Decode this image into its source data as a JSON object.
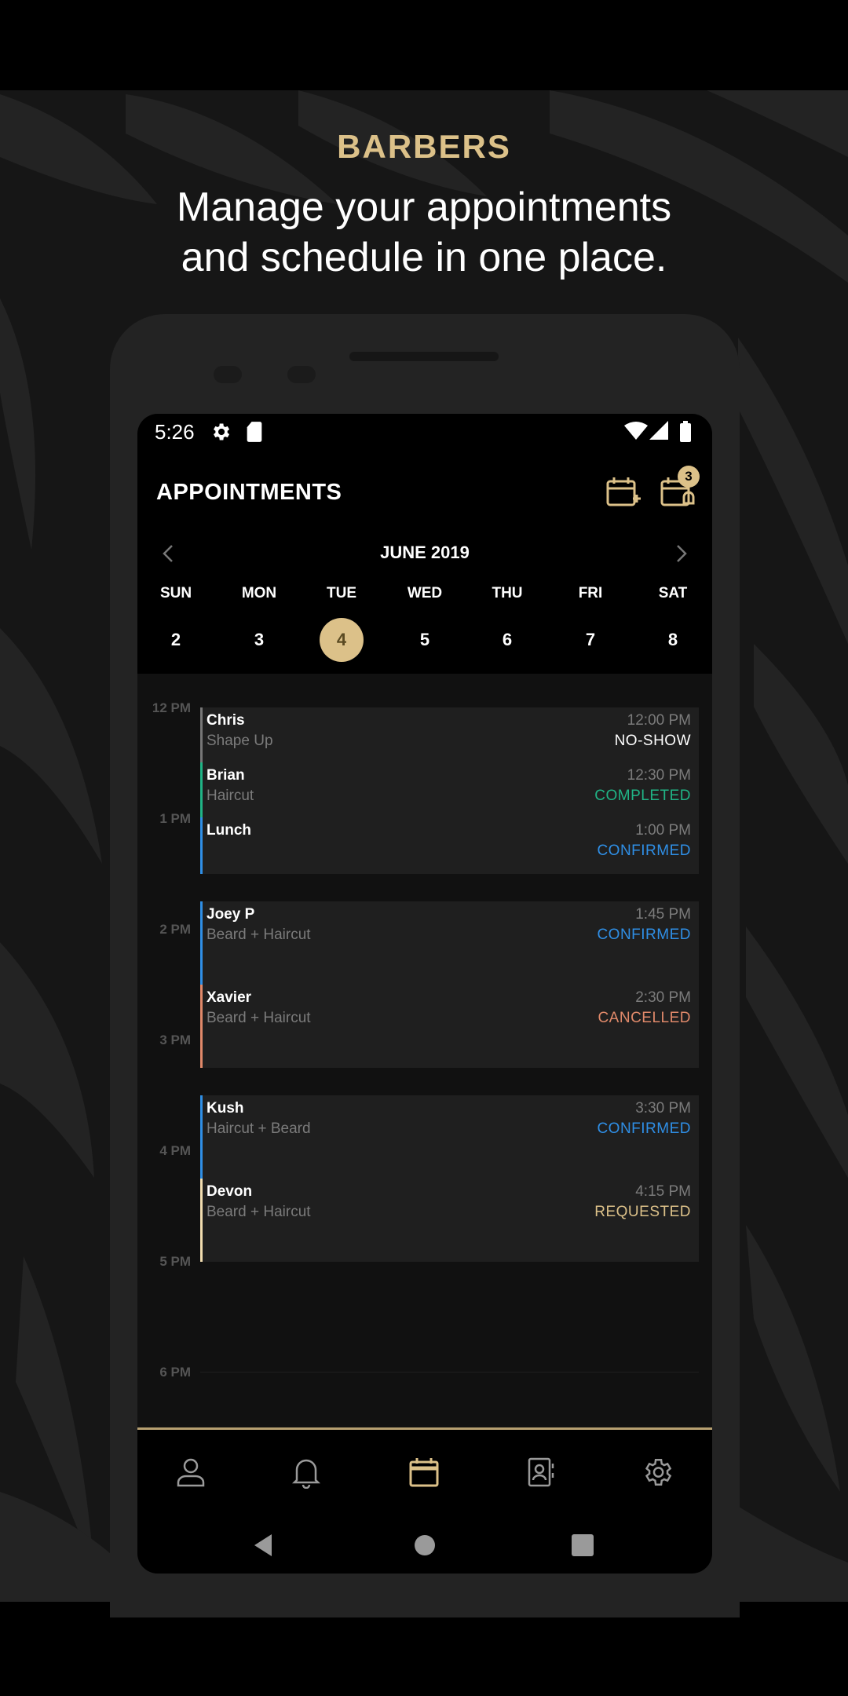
{
  "promo": {
    "brand": "BARBERS",
    "tagline_line1": "Manage your appointments",
    "tagline_line2": "and schedule in one place."
  },
  "status_bar": {
    "time": "5:26",
    "icons": [
      "gear-icon",
      "sd-card-icon",
      "wifi-icon",
      "signal-icon",
      "battery-icon"
    ]
  },
  "header": {
    "title": "APPOINTMENTS",
    "add_icon": "calendar-add-icon",
    "requests_icon": "calendar-bell-icon",
    "requests_badge": "3"
  },
  "calendar": {
    "month": "JUNE 2019",
    "weekdays": [
      "SUN",
      "MON",
      "TUE",
      "WED",
      "THU",
      "FRI",
      "SAT"
    ],
    "days": [
      "2",
      "3",
      "4",
      "5",
      "6",
      "7",
      "8"
    ],
    "selected_index": 2
  },
  "schedule": {
    "hours": [
      "12 PM",
      "1 PM",
      "2 PM",
      "3 PM",
      "4 PM",
      "5 PM",
      "6 PM"
    ],
    "appointments": [
      {
        "name": "Chris",
        "service": "Shape Up",
        "time": "12:00 PM",
        "status": "NO-SHOW",
        "status_color": "#ffffff",
        "bar_color": "#777777"
      },
      {
        "name": "Brian",
        "service": "Haircut",
        "time": "12:30 PM",
        "status": "COMPLETED",
        "status_color": "#20b486",
        "bar_color": "#20b486"
      },
      {
        "name": "Lunch",
        "service": "",
        "time": "1:00 PM",
        "status": "CONFIRMED",
        "status_color": "#2f8fe6",
        "bar_color": "#2f8fe6"
      },
      {
        "name": "Joey P",
        "service": "Beard + Haircut",
        "time": "1:45 PM",
        "status": "CONFIRMED",
        "status_color": "#2f8fe6",
        "bar_color": "#2f8fe6"
      },
      {
        "name": "Xavier",
        "service": "Beard + Haircut",
        "time": "2:30 PM",
        "status": "CANCELLED",
        "status_color": "#e0896a",
        "bar_color": "#e0896a"
      },
      {
        "name": "Kush",
        "service": "Haircut + Beard",
        "time": "3:30 PM",
        "status": "CONFIRMED",
        "status_color": "#2f8fe6",
        "bar_color": "#2f8fe6"
      },
      {
        "name": "Devon",
        "service": "Beard + Haircut",
        "time": "4:15 PM",
        "status": "REQUESTED",
        "status_color": "#dcc189",
        "bar_color": "#f2ddb0"
      }
    ]
  },
  "bottom_nav": {
    "items": [
      "profile-icon",
      "bell-icon",
      "calendar-icon",
      "contacts-icon",
      "settings-icon"
    ],
    "active_index": 2
  },
  "system_nav": {
    "items": [
      "back-icon",
      "home-icon",
      "recents-icon"
    ]
  },
  "colors": {
    "accent": "#dcc189",
    "confirmed": "#2f8fe6",
    "completed": "#20b486",
    "cancelled": "#e0896a"
  }
}
